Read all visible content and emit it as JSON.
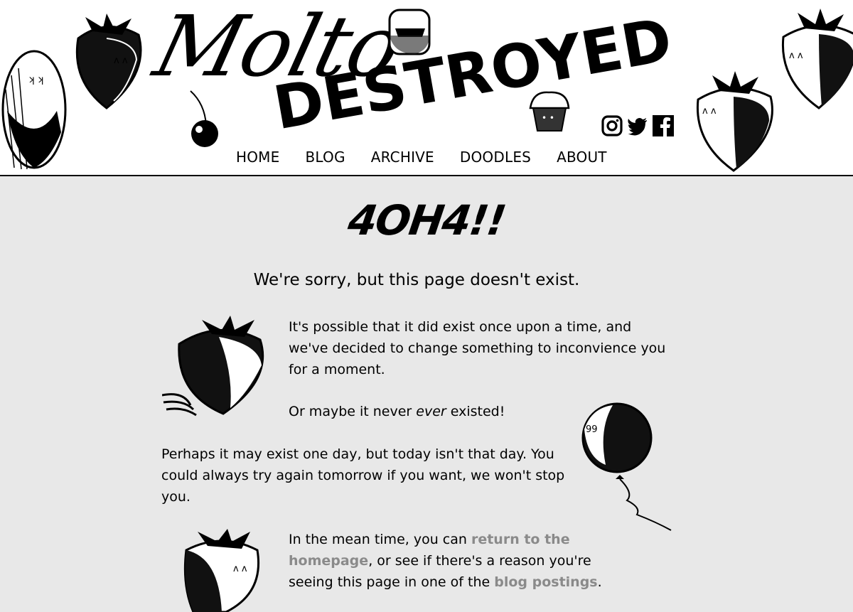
{
  "header": {
    "logo_script": "Molto",
    "logo_block": "DESTROYED",
    "social": [
      {
        "name": "instagram-icon"
      },
      {
        "name": "twitter-icon"
      },
      {
        "name": "facebook-icon"
      }
    ],
    "nav": [
      "HOME",
      "BLOG",
      "ARCHIVE",
      "DOODLES",
      "ABOUT"
    ]
  },
  "main": {
    "title": "4OH4!!",
    "subtitle": "We're sorry, but this page doesn't exist.",
    "para1": "It's possible that it did exist once upon a time, and we've decided to change something to inconvience you for a moment.",
    "para2_before": "Or maybe it never ",
    "para2_em": "ever",
    "para2_after": " existed!",
    "para3": "Perhaps it may exist one day, but today isn't that day. You could always try again tomorrow if you want, we won't stop you.",
    "para4_before": "In the mean time, you can ",
    "para4_link1": "return to the homepage",
    "para4_middle": ", or see if there's a reason you're seeing this page in one of the ",
    "para4_link2": "blog postings",
    "para4_after": "."
  }
}
